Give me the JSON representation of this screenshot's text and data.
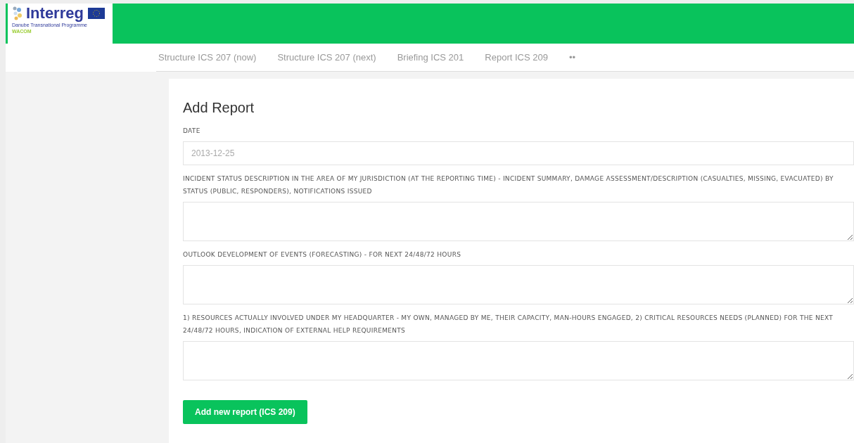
{
  "logo": {
    "name": "Interreg",
    "programme": "Danube Transnational Programme",
    "project": "WACOM"
  },
  "tabs": [
    {
      "label": "Structure ICS 207 (now)",
      "selected": false
    },
    {
      "label": "Structure ICS 207 (next)",
      "selected": false
    },
    {
      "label": "Briefing ICS 201",
      "selected": false
    },
    {
      "label": "Report ICS 209",
      "selected": false
    },
    {
      "label": "••",
      "selected": false
    }
  ],
  "form": {
    "title": "Add Report",
    "fields": [
      {
        "kind": "input",
        "label": "DATE",
        "value": "2013-12-25"
      },
      {
        "kind": "textarea",
        "label": "INCIDENT STATUS DESCRIPTION IN THE AREA OF MY JURISDICTION (AT THE REPORTING TIME) - INCIDENT SUMMARY, DAMAGE ASSESSMENT/DESCRIPTION (CASUALTIES, MISSING, EVACUATED) BY STATUS (PUBLIC, RESPONDERS), NOTIFICATIONS ISSUED"
      },
      {
        "kind": "textarea",
        "label": "OUTLOOK DEVELOPMENT OF EVENTS (FORECASTING) - FOR NEXT 24/48/72 HOURS"
      },
      {
        "kind": "textarea",
        "label": "1) RESOURCES ACTUALLY INVOLVED UNDER MY HEADQUARTER - MY OWN, MANAGED BY ME, THEIR CAPACITY, MAN-HOURS ENGAGED, 2) CRITICAL RESOURCES NEEDS (PLANNED) FOR THE NEXT 24/48/72 HOURS, INDICATION OF EXTERNAL HELP REQUIREMENTS"
      }
    ],
    "submit": "Add new report (ICS 209)"
  }
}
